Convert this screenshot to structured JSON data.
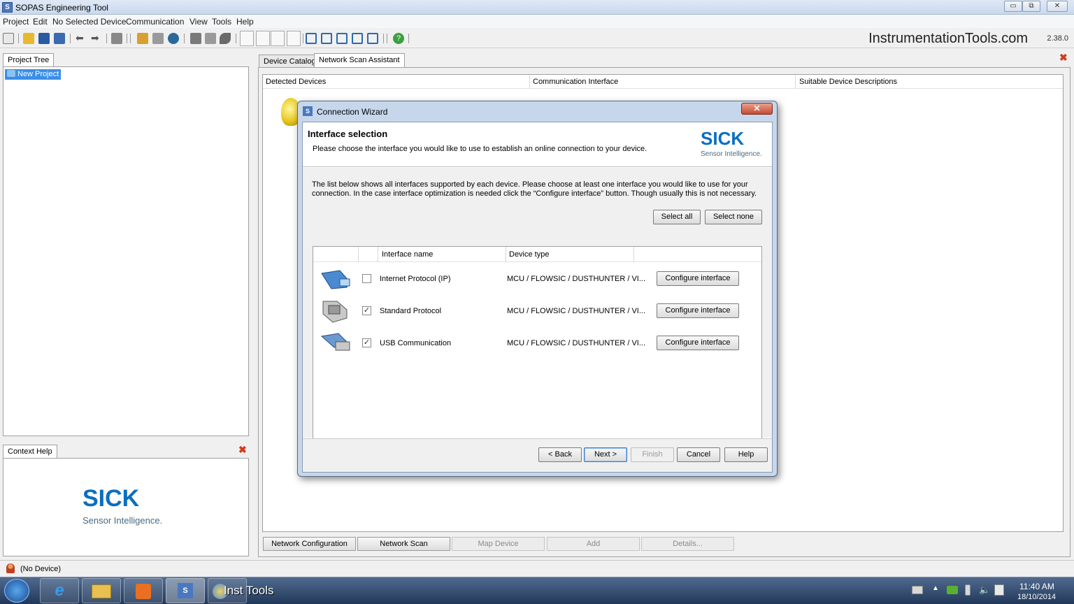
{
  "window": {
    "title": "SOPAS Engineering Tool",
    "buttons": [
      "▭",
      "⧉",
      "✕"
    ]
  },
  "menu": [
    "Project",
    "Edit",
    "No Selected Device",
    "Communication",
    "View",
    "Tools",
    "Help"
  ],
  "toolbar": {
    "brand": "InstrumentationTools.com",
    "version": "2.38.0"
  },
  "project_tree": {
    "tab": "Project Tree",
    "item": "New Project"
  },
  "context_help": {
    "tab": "Context Help",
    "logo": "SICK",
    "tagline": "Sensor Intelligence."
  },
  "workspace": {
    "tabs": [
      "Device Catalog",
      "Network Scan Assistant"
    ],
    "columns": [
      "Detected Devices",
      "Communication Interface",
      "Suitable Device Descriptions"
    ],
    "buttons": [
      {
        "label": "Network Configuration",
        "enabled": true
      },
      {
        "label": "Network Scan",
        "enabled": true
      },
      {
        "label": "Map Device",
        "enabled": false
      },
      {
        "label": "Add",
        "enabled": false
      },
      {
        "label": "Details...",
        "enabled": false
      }
    ]
  },
  "dialog": {
    "title": "Connection Wizard",
    "heading": "Interface selection",
    "subheading": "Please choose the interface you would like to use to establish an online connection to your device.",
    "logo": "SICK",
    "logo_tagline": "Sensor Intelligence.",
    "description": "The list below shows all interfaces supported by each device. Please choose at least one interface you would like to use for your connection. In the case interface optimization is needed click the “Configure interface” button. Though usually this is not necessary.",
    "select_all": "Select all",
    "select_none": "Select none",
    "columns": [
      "Interface name",
      "Device type"
    ],
    "rows": [
      {
        "name": "Internet Protocol (IP)",
        "device_type": "MCU / FLOWSIC / DUSTHUNTER / VI...",
        "checked": "",
        "button": "Configure interface",
        "icon": "ethernet-cable-icon"
      },
      {
        "name": "Standard Protocol",
        "device_type": "MCU / FLOWSIC / DUSTHUNTER / VI...",
        "checked": "✓",
        "button": "Configure interface",
        "icon": "serial-connector-icon"
      },
      {
        "name": "USB Communication",
        "device_type": "MCU / FLOWSIC / DUSTHUNTER / VI...",
        "checked": "✓",
        "button": "Configure interface",
        "icon": "usb-plug-icon"
      }
    ],
    "footer": {
      "back": "< Back",
      "next": "Next >",
      "finish": "Finish",
      "cancel": "Cancel",
      "help": "Help"
    }
  },
  "status": {
    "device": "(No Device)"
  },
  "taskbar": {
    "task_label": "Inst Tools",
    "time": "11:40 AM",
    "date": "18/10/2014"
  }
}
